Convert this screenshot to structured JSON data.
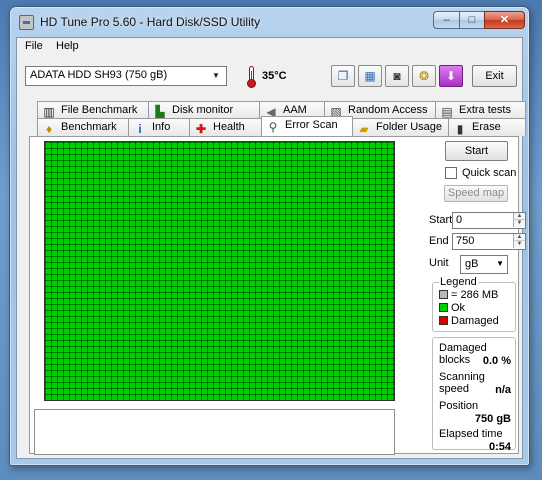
{
  "window": {
    "title": "HD Tune Pro 5.60 - Hard Disk/SSD Utility",
    "minimize": "–",
    "maximize": "□",
    "close": "✕",
    "app_icon": "disk-app-icon"
  },
  "menu": {
    "file": "File",
    "help": "Help"
  },
  "toolbar": {
    "drive": "ADATA   HDD SH93 (750 gB)",
    "temperature": "35°C",
    "buttons": [
      "copy-info-icon",
      "copy-screen-icon",
      "screenshot-camera-icon",
      "options-coins-icon",
      "save-download-icon"
    ],
    "exit_label": "Exit"
  },
  "tabs": {
    "row1": [
      {
        "label": "File Benchmark",
        "icon": "file-benchmark-icon"
      },
      {
        "label": "Disk monitor",
        "icon": "disk-monitor-icon"
      },
      {
        "label": "AAM",
        "icon": "speaker-icon"
      },
      {
        "label": "Random Access",
        "icon": "random-access-icon"
      },
      {
        "label": "Extra tests",
        "icon": "extra-tests-icon"
      }
    ],
    "row2": [
      {
        "label": "Benchmark",
        "icon": "benchmark-icon"
      },
      {
        "label": "Info",
        "icon": "info-icon"
      },
      {
        "label": "Health",
        "icon": "health-cross-icon"
      },
      {
        "label": "Error Scan",
        "icon": "magnifier-icon",
        "active": true
      },
      {
        "label": "Folder Usage",
        "icon": "folder-icon"
      },
      {
        "label": "Erase",
        "icon": "trash-icon"
      }
    ]
  },
  "scan": {
    "start_label": "Start",
    "quick_scan_label": "Quick scan",
    "quick_scan_checked": false,
    "speed_map_label": "Speed map",
    "start_field_label": "Start",
    "start_value": "0",
    "end_field_label": "End",
    "end_value": "750",
    "unit_label": "Unit",
    "unit_value": "gB",
    "legend": {
      "title": "Legend",
      "items": [
        {
          "label": "= 286 MB",
          "color": "#b8b8b8"
        },
        {
          "label": "Ok",
          "color": "#00d000"
        },
        {
          "label": "Damaged",
          "color": "#e00000"
        }
      ]
    },
    "block_color_ok": "#00d000",
    "stats": {
      "damaged_blocks_label": "Damaged blocks",
      "damaged_blocks_value": "0.0 %",
      "scanning_speed_label": "Scanning speed",
      "scanning_speed_value": "n/a",
      "position_label": "Position",
      "position_value": "750 gB",
      "elapsed_label": "Elapsed time",
      "elapsed_value": "0:54"
    }
  }
}
